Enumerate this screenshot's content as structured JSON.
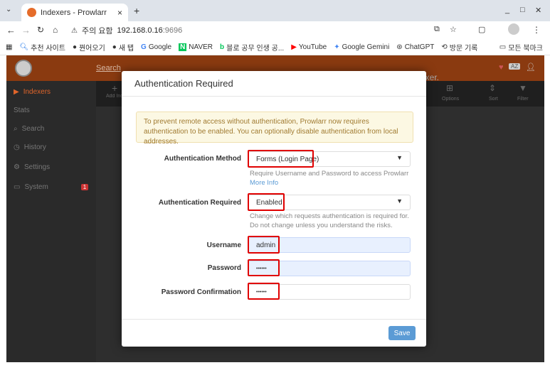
{
  "browser": {
    "tab_title": "Indexers - Prowlarr",
    "new_tab": "+",
    "window_controls": [
      "_",
      "□",
      "✕"
    ],
    "security_label": "주의 요함",
    "url_host": "192.168.0.16",
    "url_port": ":9696",
    "bookmarks": [
      "추천 사이트",
      "꿘어오기",
      "새 탭",
      "Google",
      "NAVER",
      "블로 공무 인생 공...",
      "YouTube",
      "Google Gemini",
      "ChatGPT",
      "방문 기록"
    ],
    "all_bookmarks": "모든 북마크"
  },
  "app": {
    "search_label": "Search",
    "sidebar": [
      {
        "label": "Indexers",
        "icon": "play-icon",
        "active": true
      },
      {
        "label": "Stats",
        "icon": "",
        "active": false
      },
      {
        "label": "Search",
        "icon": "search-icon",
        "active": false
      },
      {
        "label": "History",
        "icon": "history-icon",
        "active": false
      },
      {
        "label": "Settings",
        "icon": "gear-icon",
        "active": false
      },
      {
        "label": "System",
        "icon": "monitor-icon",
        "active": false
      }
    ],
    "system_badge": "1",
    "toolbar": {
      "add_label": "Add Indexer",
      "options_label": "Options",
      "sort_label": "Sort",
      "filter_label": "Filter"
    },
    "content_text": "exer."
  },
  "modal": {
    "title": "Authentication Required",
    "alert": "To prevent remote access without authentication, Prowlarr now requires authentication to be enabled. You can optionally disable authentication from local addresses.",
    "fields": {
      "auth_method_label": "Authentication Method",
      "auth_method_value": "Forms (Login Page)",
      "auth_method_help": "Require Username and Password to access Prowlarr",
      "more_info": "More Info",
      "auth_required_label": "Authentication Required",
      "auth_required_value": "Enabled",
      "auth_required_help": "Change which requests authentication is required for. Do not change unless you understand the risks.",
      "username_label": "Username",
      "username_value": "admin",
      "password_label": "Password",
      "password_value": "••••••",
      "password_confirm_label": "Password Confirmation",
      "password_confirm_value": "••••••"
    },
    "save_label": "Save"
  }
}
